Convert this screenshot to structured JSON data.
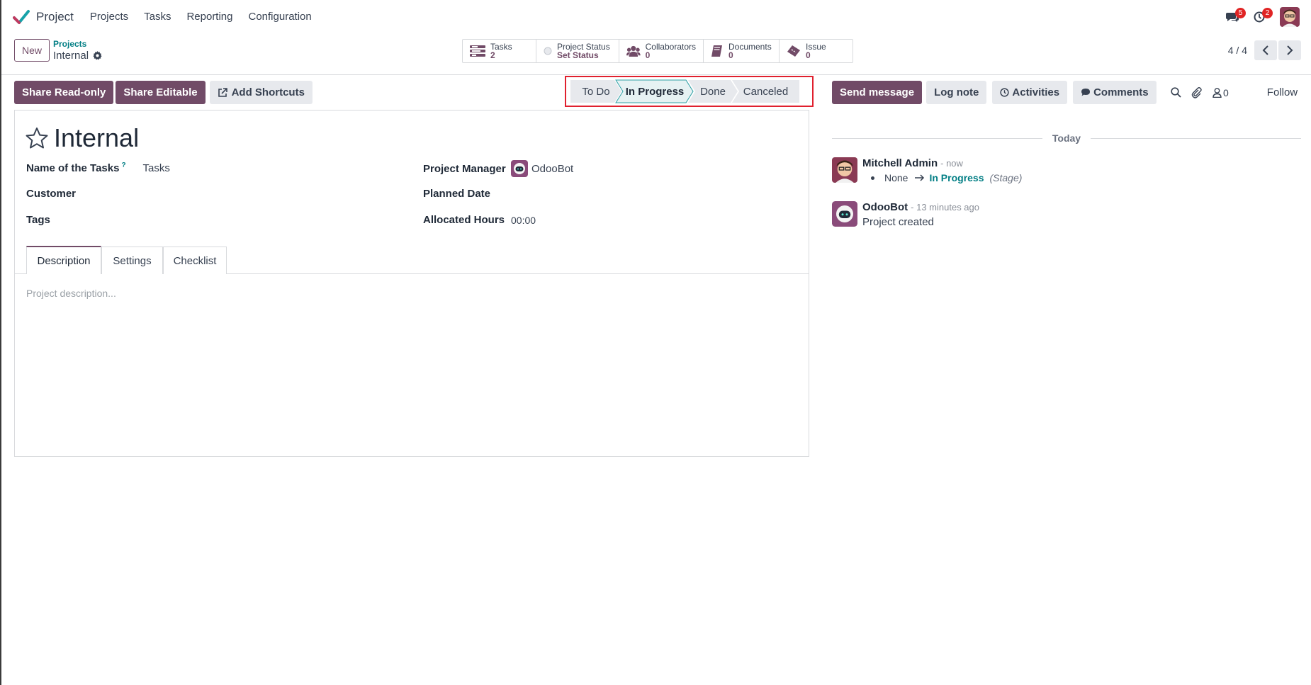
{
  "app": {
    "name": "Project",
    "menu": [
      "Projects",
      "Tasks",
      "Reporting",
      "Configuration"
    ],
    "messages_badge": "5",
    "activities_badge": "2",
    "brand_color": "#714b67",
    "accent_color": "#017e84"
  },
  "control_panel": {
    "new_label": "New",
    "breadcrumb_parent": "Projects",
    "breadcrumb_current": "Internal",
    "pager_value": "4 / 4"
  },
  "smart_buttons": {
    "tasks": {
      "label": "Tasks",
      "value": "2",
      "icon": "tasks-icon"
    },
    "status": {
      "label": "Project Status",
      "value": "Set Status",
      "icon": "status-circle-icon"
    },
    "collaborators": {
      "label": "Collaborators",
      "value": "0",
      "icon": "users-icon"
    },
    "documents": {
      "label": "Documents",
      "value": "0",
      "icon": "book-icon"
    },
    "issue": {
      "label": "Issue",
      "value": "0",
      "icon": "ticket-icon"
    }
  },
  "actions": {
    "share_readonly": "Share Read-only",
    "share_editable": "Share Editable",
    "add_shortcuts": "Add Shortcuts"
  },
  "stages": {
    "todo": "To Do",
    "in_progress": "In Progress",
    "done": "Done",
    "canceled": "Canceled",
    "active": "In Progress",
    "highlight_color": "#e0202e"
  },
  "form": {
    "title": "Internal",
    "tasks_name_label": "Name of the Tasks",
    "tasks_name_help": "?",
    "tasks_name_value": "Tasks",
    "customer_label": "Customer",
    "tags_label": "Tags",
    "manager_label": "Project Manager",
    "manager_value": "OdooBot",
    "planned_label": "Planned Date",
    "allocated_label": "Allocated Hours",
    "allocated_value": "00:00",
    "tabs": {
      "description": "Description",
      "settings": "Settings",
      "checklist": "Checklist"
    },
    "active_tab": "Description",
    "description_placeholder": "Project description..."
  },
  "chatter": {
    "send_message": "Send message",
    "log_note": "Log note",
    "activities": "Activities",
    "comments": "Comments",
    "followers_count": "0",
    "follow": "Follow",
    "divider": "Today",
    "messages": [
      {
        "author": "Mitchell Admin",
        "time": "- now",
        "old_value": "None",
        "new_value": "In Progress",
        "field": "(Stage)"
      },
      {
        "author": "OdooBot",
        "time": "- 13 minutes ago",
        "body": "Project created"
      }
    ]
  }
}
